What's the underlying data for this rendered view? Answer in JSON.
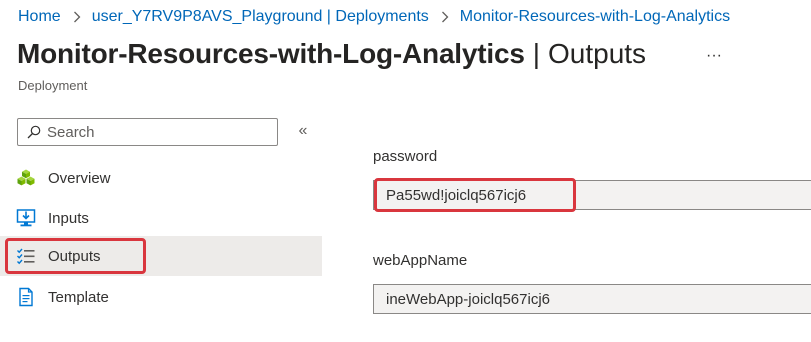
{
  "breadcrumb": {
    "items": [
      "Home",
      "user_Y7RV9P8AVS_Playground | Deployments",
      "Monitor-Resources-with-Log-Analytics"
    ]
  },
  "header": {
    "title": "Monitor-Resources-with-Log-Analytics",
    "separator": "|",
    "section": "Outputs",
    "more_label": "···",
    "subtitle": "Deployment"
  },
  "sidebar": {
    "search_placeholder": "Search",
    "collapse_label": "«",
    "items": [
      {
        "label": "Overview",
        "icon": "overview-icon",
        "selected": false
      },
      {
        "label": "Inputs",
        "icon": "inputs-icon",
        "selected": false
      },
      {
        "label": "Outputs",
        "icon": "outputs-icon",
        "selected": true
      },
      {
        "label": "Template",
        "icon": "template-icon",
        "selected": false
      }
    ]
  },
  "outputs": [
    {
      "label": "password",
      "value": "Pa55wd!joiclq567icj6",
      "highlighted": true
    },
    {
      "label": "webAppName",
      "value": "ineWebApp-joiclq567icj6",
      "highlighted": false
    }
  ],
  "colors": {
    "link": "#0067b8",
    "highlight": "#d9363e",
    "selected_bg": "#edebe9",
    "field_bg": "#f3f2f1"
  }
}
